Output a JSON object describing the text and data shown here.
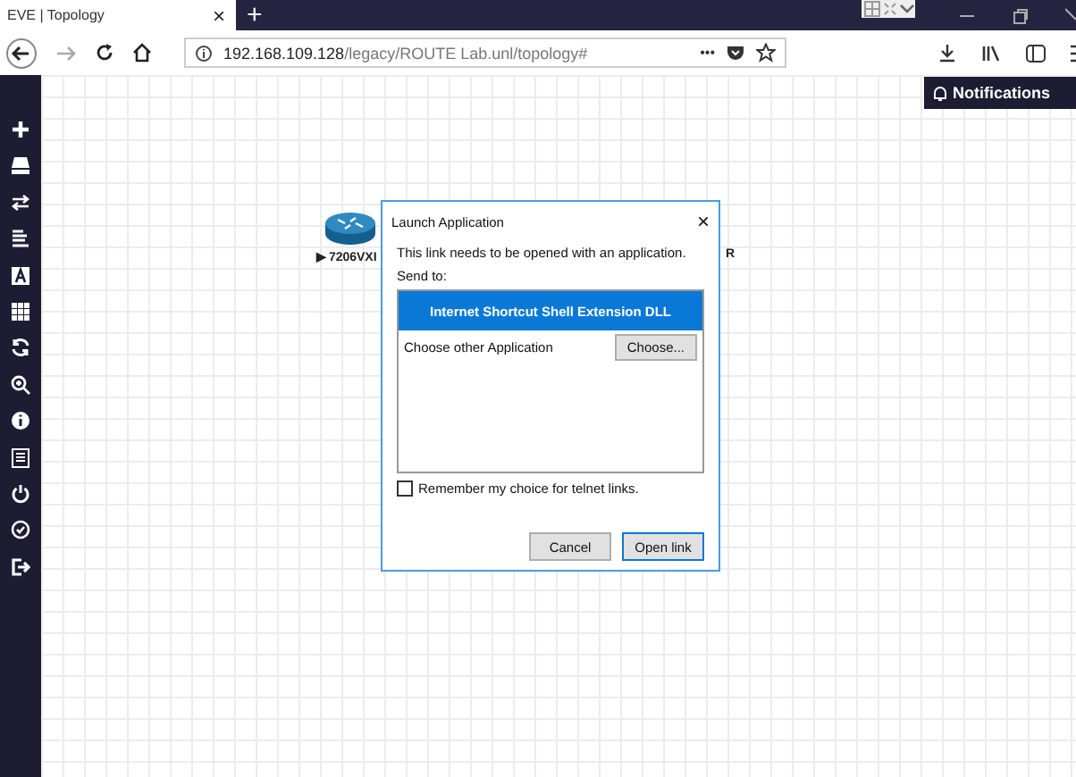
{
  "browser": {
    "tab": {
      "title": "EVE | Topology",
      "close": "×"
    },
    "new_tab": "+",
    "address": {
      "host": "192.168.109.128",
      "path": "/legacy/ROUTE Lab.unl/topology#"
    },
    "page_actions": "•••"
  },
  "notifications": {
    "label": "Notifications"
  },
  "canvas": {
    "nodes": [
      {
        "label": "▶ 7206VXI"
      }
    ],
    "covered_label_end": "R"
  },
  "dialog": {
    "title": "Launch Application",
    "close": "×",
    "message": "This link needs to be opened with an application.",
    "send_to": "Send to:",
    "apps": [
      {
        "label": "Internet Shortcut Shell Extension DLL",
        "selected": true
      },
      {
        "label": "Choose other Application",
        "selected": false,
        "button": "Choose..."
      }
    ],
    "remember": {
      "label": "Remember my choice for telnet links.",
      "checked": false
    },
    "buttons": [
      {
        "label": "Cancel",
        "default": false
      },
      {
        "label": "Open link",
        "default": true
      }
    ]
  }
}
